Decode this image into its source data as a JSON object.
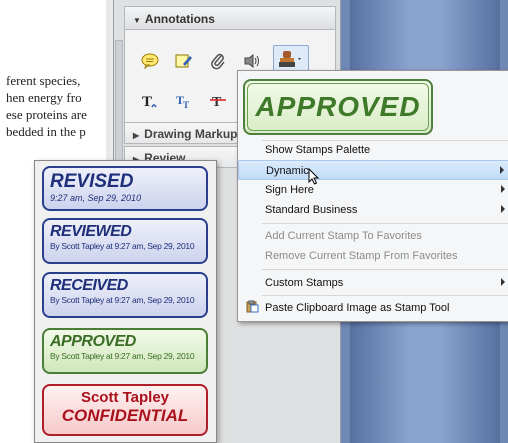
{
  "document": {
    "lines": [
      "ferent species,",
      "hen energy fro",
      "ese proteins are",
      "bedded in the p"
    ]
  },
  "panel": {
    "annotations_header": "Annotations",
    "drawing_markup": "Drawing Markup",
    "review_partial": "Review"
  },
  "icons": {
    "sticky_note": "sticky-note-icon",
    "highlight_text": "highlight-text-icon",
    "attach_file": "attach-file-icon",
    "record_audio": "record-audio-icon",
    "add_stamp": "add-stamp-icon",
    "text_comment": "text-comment-icon",
    "replace_text": "replace-text-icon",
    "strikethrough": "strikethrough-icon"
  },
  "menu": {
    "preview_text": "APPROVED",
    "items": [
      {
        "label": "Show Stamps Palette",
        "has_submenu": false,
        "disabled": false,
        "highlighted": false
      },
      {
        "label": "Dynamic",
        "has_submenu": true,
        "disabled": false,
        "highlighted": true
      },
      {
        "label": "Sign Here",
        "has_submenu": true,
        "disabled": false,
        "highlighted": false
      },
      {
        "label": "Standard Business",
        "has_submenu": true,
        "disabled": false,
        "highlighted": false
      },
      {
        "label": "Add Current Stamp To Favorites",
        "has_submenu": false,
        "disabled": true,
        "highlighted": false
      },
      {
        "label": "Remove Current Stamp From Favorites",
        "has_submenu": false,
        "disabled": true,
        "highlighted": false
      },
      {
        "label": "Custom Stamps",
        "has_submenu": true,
        "disabled": false,
        "highlighted": false
      },
      {
        "label": "Paste Clipboard Image as Stamp Tool",
        "has_submenu": false,
        "disabled": false,
        "highlighted": false
      }
    ]
  },
  "stamps": [
    {
      "title": "REVISED",
      "subtitle": "9:27 am, Sep 29, 2010",
      "color": "blue"
    },
    {
      "title": "REVIEWED",
      "subtitle": "By Scott Tapley at 9:27 am, Sep 29, 2010",
      "color": "blue"
    },
    {
      "title": "RECEIVED",
      "subtitle": "By Scott Tapley at 9:27 am, Sep 29, 2010",
      "color": "blue"
    },
    {
      "title": "APPROVED",
      "subtitle": "By Scott Tapley at 9:27 am, Sep 29, 2010",
      "color": "green"
    },
    {
      "title": "Scott Tapley",
      "subtitle": "CONFIDENTIAL",
      "color": "red"
    }
  ],
  "colors": {
    "accent_blue": "#2a3f8c",
    "approved_green": "#3e7a2a",
    "confidential_red": "#a9121d",
    "menu_highlight": "#c1dcf8"
  }
}
